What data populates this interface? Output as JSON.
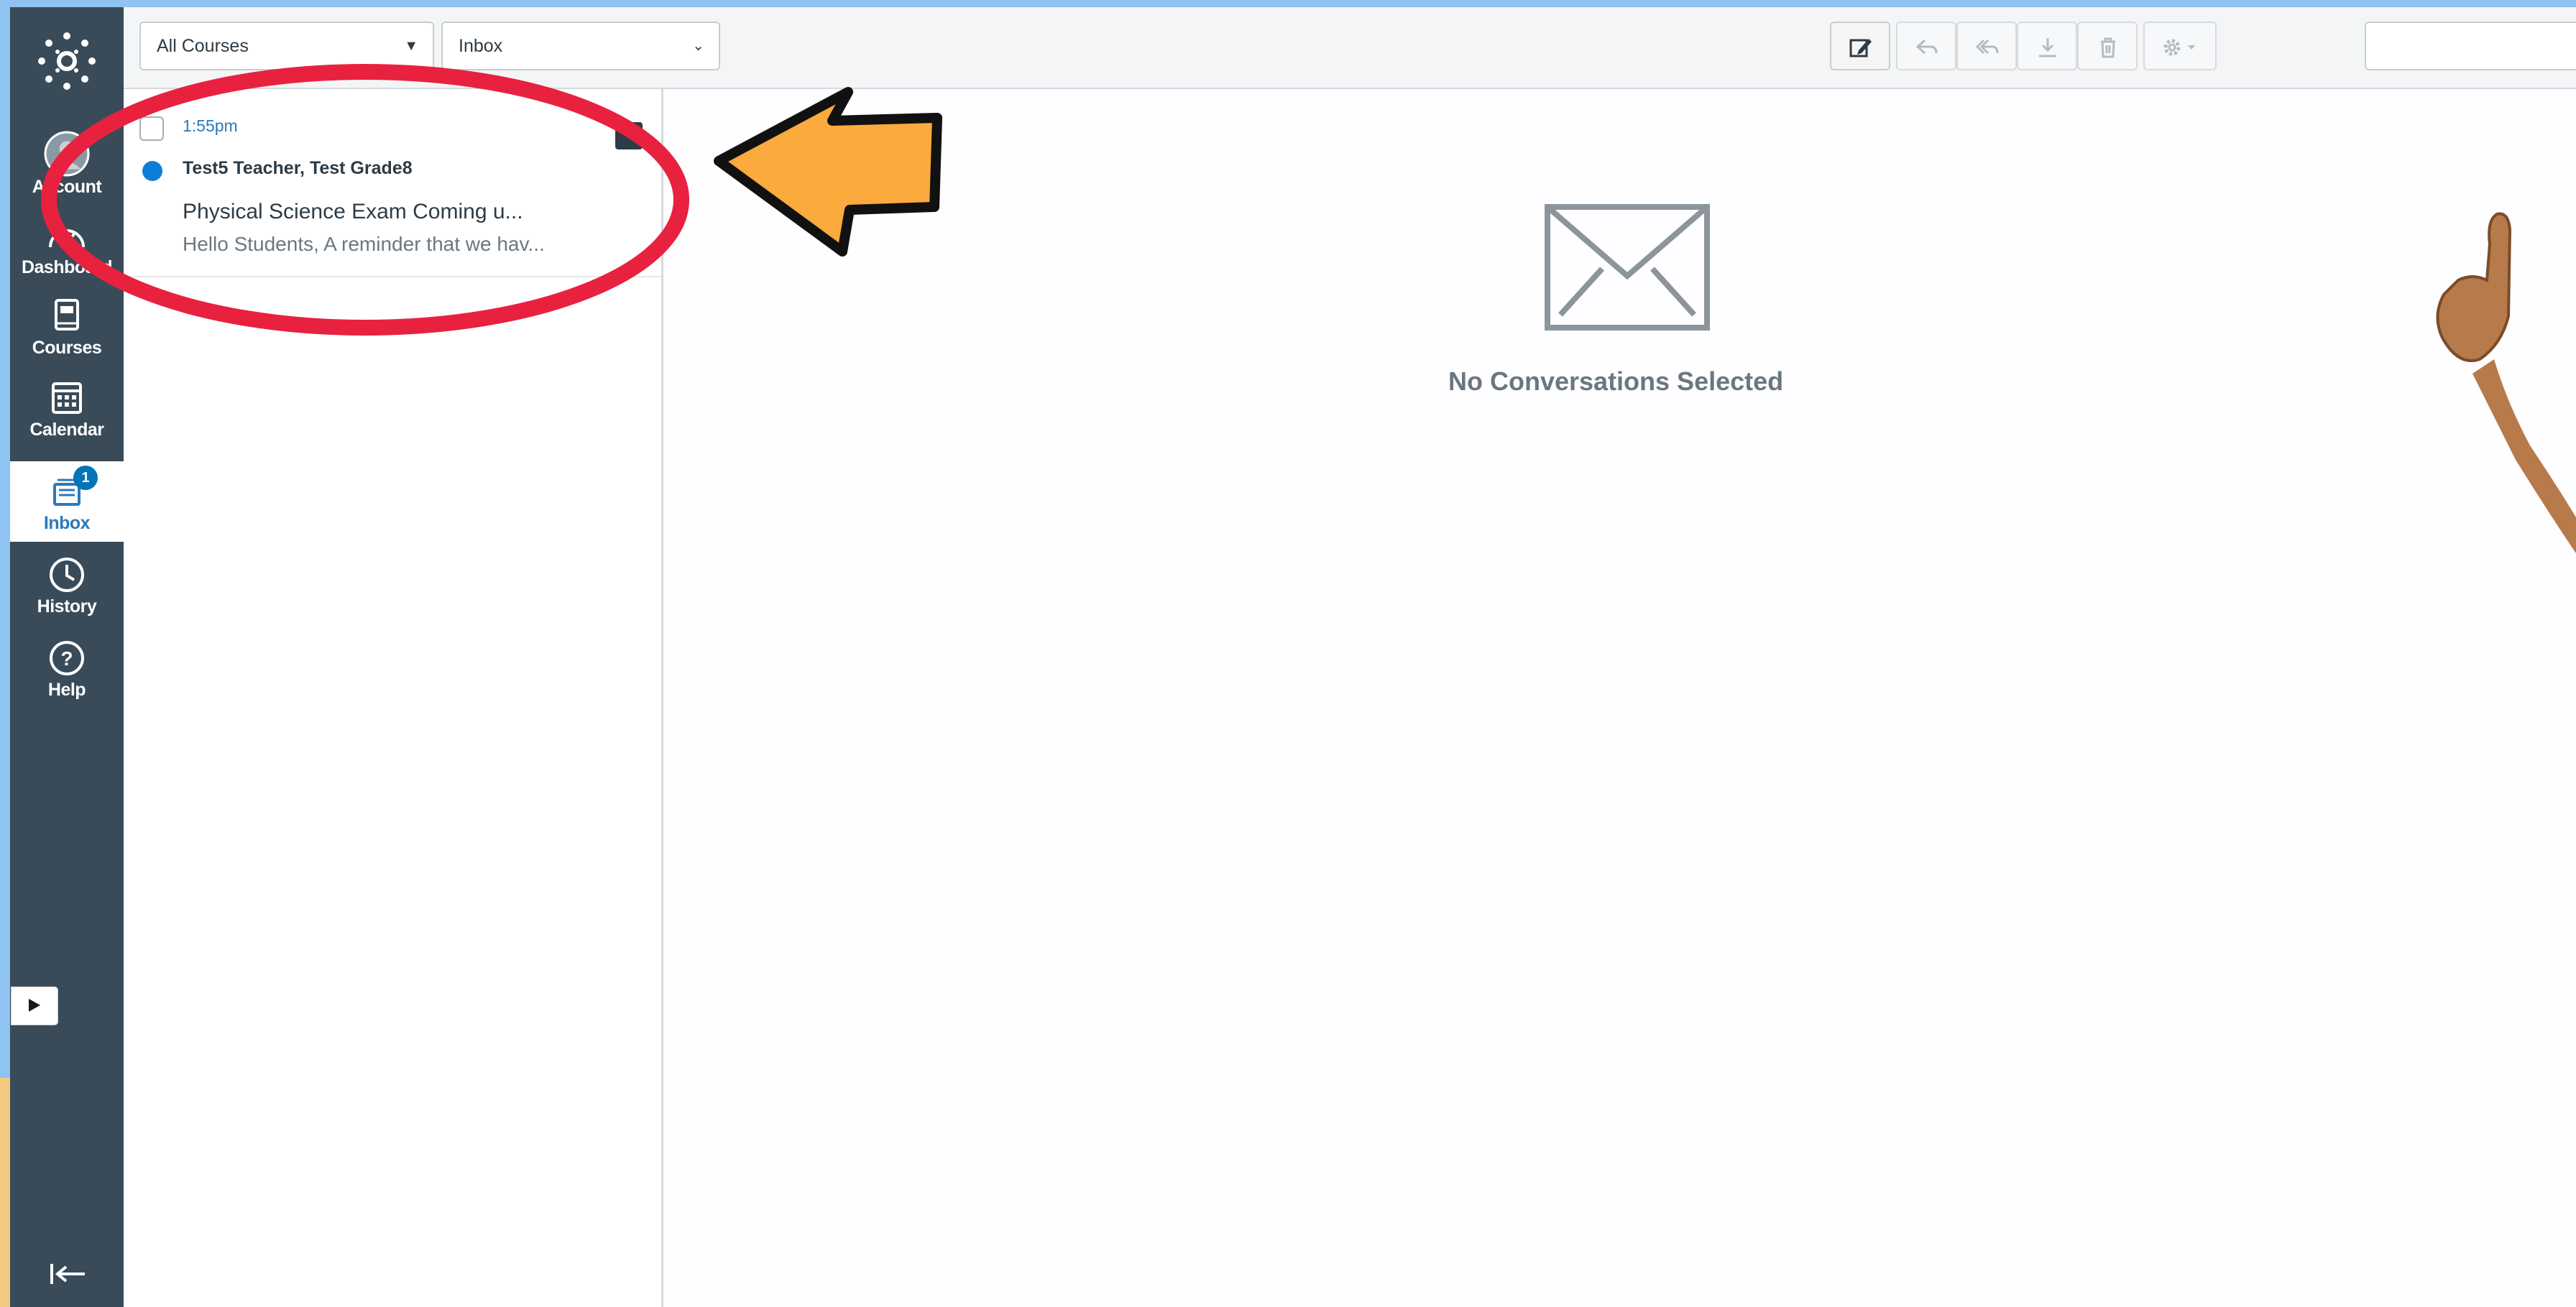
{
  "nav": {
    "items": [
      {
        "label": "Account",
        "icon": "account-avatar-icon"
      },
      {
        "label": "Dashboard",
        "icon": "dashboard-icon"
      },
      {
        "label": "Courses",
        "icon": "courses-icon"
      },
      {
        "label": "Calendar",
        "icon": "calendar-icon"
      },
      {
        "label": "Inbox",
        "icon": "inbox-icon",
        "active": true,
        "badge": "1"
      },
      {
        "label": "History",
        "icon": "history-icon"
      },
      {
        "label": "Help",
        "icon": "help-icon"
      }
    ]
  },
  "toolbar": {
    "course_filter": "All Courses",
    "mailbox_filter": "Inbox",
    "search_value": ""
  },
  "conversations": [
    {
      "time": "1:55pm",
      "from": "Test5 Teacher, Test Grade8",
      "subject": "Physical Science Exam Coming u...",
      "preview": "Hello Students, A reminder that we hav...",
      "unread": true
    }
  ],
  "message_pane": {
    "empty_text": "No Conversations Selected"
  },
  "colors": {
    "nav_bg": "#394b58",
    "accent": "#0374b5",
    "annotation_red": "#e8213f",
    "annotation_orange": "#fbab3d"
  }
}
